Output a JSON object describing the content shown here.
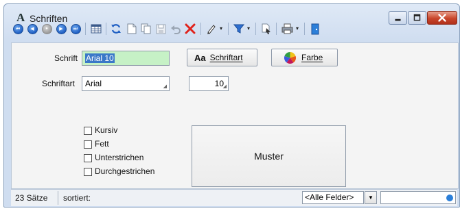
{
  "window": {
    "app_icon_glyph": "A",
    "title": "Schriften",
    "controls": {
      "minimize_icon": "minimize-icon",
      "maximize_icon": "maximize-icon",
      "close_icon": "close-icon"
    }
  },
  "toolbar": {
    "nav": [
      "first-record-icon",
      "previous-record-icon",
      "stop-icon",
      "next-record-icon",
      "last-record-icon"
    ],
    "nav_glyphs": [
      "⏮",
      "◀",
      "●",
      "▶",
      "⏭"
    ],
    "drop_glyph": "▾"
  },
  "form": {
    "schrift_label": "Schrift",
    "schrift_value": "Arial 10",
    "schriftart_label": "Schriftart",
    "schriftart_value": "Arial",
    "size_value": "10",
    "schriftart_button": {
      "prefix": "Aa",
      "label": "Schriftart"
    },
    "farbe_button": {
      "label": "Farbe"
    },
    "checkboxes": [
      {
        "label": "Kursiv",
        "checked": false
      },
      {
        "label": "Fett",
        "checked": false
      },
      {
        "label": "Unterstrichen",
        "checked": false
      },
      {
        "label": "Durchgestrichen",
        "checked": false
      }
    ],
    "preview_text": "Muster"
  },
  "status": {
    "count": "23 Sätze",
    "sort": "sortiert:",
    "field_filter": "<Alle Felder>",
    "search_value": ""
  },
  "colors": {
    "accent": "#1f5fc3",
    "close": "#c9462b",
    "selection": "#3a78c8",
    "field_highlight": "#c6f1c6"
  }
}
